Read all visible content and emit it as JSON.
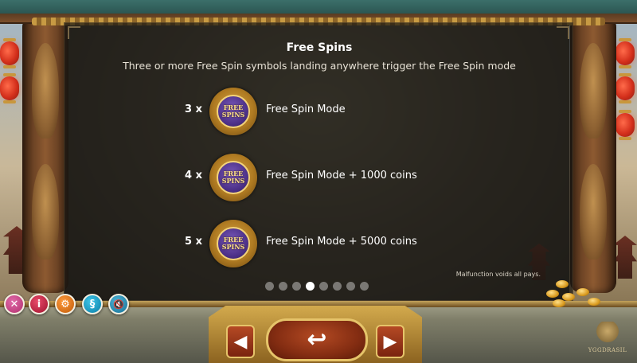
{
  "paytable": {
    "title": "Free Spins",
    "subtitle": "Three or more Free Spin symbols landing anywhere trigger the Free Spin mode",
    "symbol_text": "FREE SPINS",
    "rows": [
      {
        "count": "3 x",
        "description": "Free Spin Mode"
      },
      {
        "count": "4 x",
        "description": "Free Spin Mode + 1000 coins"
      },
      {
        "count": "5 x",
        "description": "Free Spin Mode + 5000 coins"
      }
    ],
    "pagination": {
      "total_pages": 8,
      "current_page": 4
    },
    "disclaimer": "Malfunction voids all pays."
  },
  "toolbar": {
    "close_label": "✕",
    "info_label": "i",
    "settings_label": "⚙",
    "rules_label": "§",
    "sound_label": "🔇"
  },
  "navigation": {
    "prev_label": "◀",
    "back_label": "↩",
    "next_label": "▶"
  },
  "branding": {
    "logo_text": "YGGDRASIL"
  },
  "colors": {
    "panel_bg": "#1a1814",
    "accent_gold": "#e6c46a",
    "button_red": "#842d12",
    "dot_active": "#ffffff",
    "dot_inactive": "#7a7874"
  }
}
